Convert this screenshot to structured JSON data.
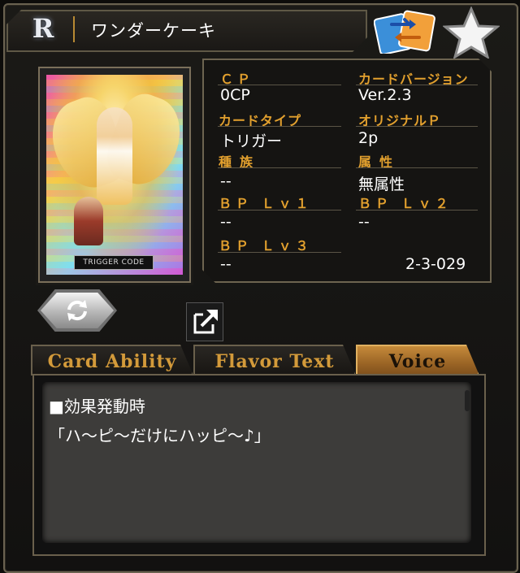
{
  "header": {
    "rarity": "R",
    "card_name": "ワンダーケーキ"
  },
  "card": {
    "trigger_label": "TRIGGER CODE"
  },
  "stats": {
    "cp_label": "ＣＰ",
    "cp_value": "0CP",
    "version_label": "カードバージョン",
    "version_value": "Ver.2.3",
    "type_label": "カードタイプ",
    "type_value": "トリガー",
    "original_label": "オリジナルＰ",
    "original_value": "2p",
    "race_label": "種族",
    "race_value": "--",
    "attribute_label": "属性",
    "attribute_value": "無属性",
    "bp1_label": "ＢＰ Ｌｖ１",
    "bp1_value": "--",
    "bp2_label": "ＢＰ Ｌｖ２",
    "bp2_value": "--",
    "bp3_label": "ＢＰ Ｌｖ３",
    "bp3_value": "--",
    "card_number": "2-3-029"
  },
  "tabs": [
    {
      "label": "Card Ability",
      "active": false
    },
    {
      "label": "Flavor Text",
      "active": false
    },
    {
      "label": "Voice",
      "active": true
    }
  ],
  "voice": {
    "line1": "■効果発動時",
    "line2": "「ハ～ピ～だけにハッピ～♪」"
  },
  "icons": {
    "swap": "swap-cards-icon",
    "favorite": "star-icon",
    "expand": "expand-icon",
    "reload": "reload-icon"
  },
  "colors": {
    "label_gold": "#e2a02e",
    "active_tab": "#c58a3a",
    "border": "#6a604c"
  }
}
